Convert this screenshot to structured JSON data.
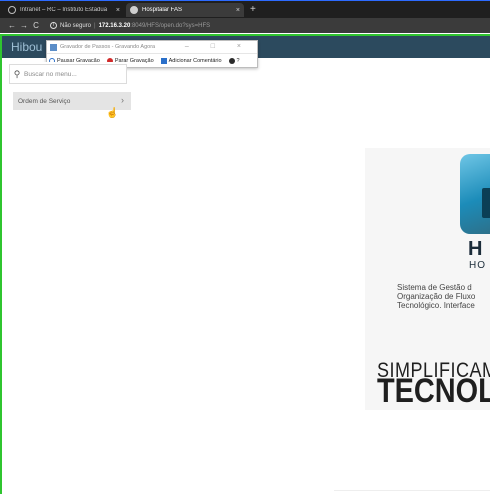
{
  "browser": {
    "tabs": [
      {
        "title": "Intranet – RC – Instituto Estadua",
        "close": "×"
      },
      {
        "title": "Hospitalar FAS",
        "close": "×"
      }
    ],
    "new_tab": "+",
    "nav": {
      "back": "←",
      "forward": "→",
      "reload": "C"
    },
    "address": {
      "security_label": "Não seguro",
      "host": "172.16.3.20",
      "path": ":8049/HFS/open.do?sys=HFS"
    }
  },
  "app": {
    "brand": "Hibou",
    "search_placeholder": "Buscar no menu...",
    "menu_items": [
      {
        "label": "Ordem de Serviço"
      }
    ]
  },
  "recorder": {
    "title": "Gravador de Passos - Gravando Agora",
    "tools": {
      "pause": "Pausar Gravação",
      "stop": "Parar Gravação",
      "comment": "Adicionar Comentário",
      "help": "?"
    }
  },
  "splash": {
    "logo_letter": "H",
    "logo_sub": "HO",
    "description": [
      "Sistema de Gestão d",
      "Organização de Fluxo",
      "Tecnológico. Interface"
    ],
    "slogan_line1": "SIMPLIFICAMC",
    "slogan_line2": "TECNOL"
  },
  "colors": {
    "header": "#2c4a5e",
    "recorder_border": "#2fc52f",
    "logo_gradient_start": "#6fc6e6",
    "logo_gradient_end": "#2e6e86"
  }
}
